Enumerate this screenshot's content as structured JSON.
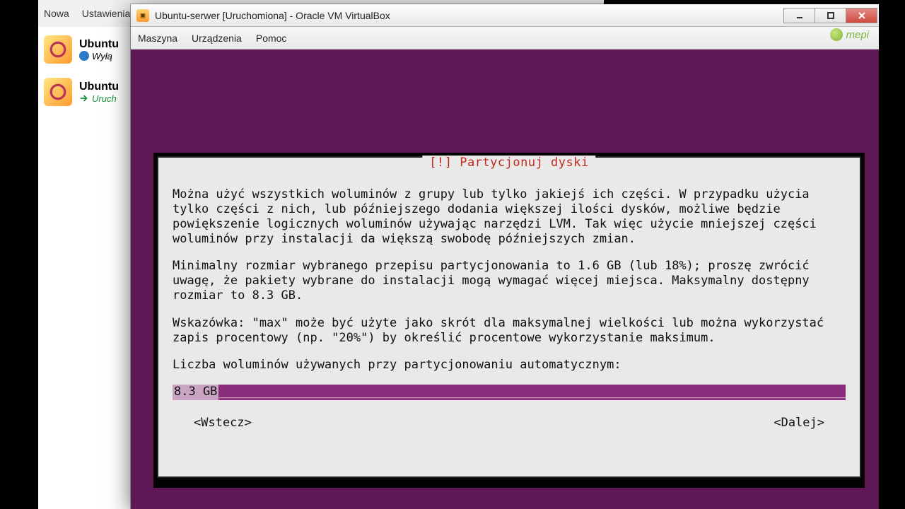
{
  "manager": {
    "toolbar": {
      "nowa": "Nowa",
      "ustawienia": "Ustawienia"
    },
    "vms": [
      {
        "name": "Ubuntu",
        "state_label": "Wyłą",
        "state": "off"
      },
      {
        "name": "Ubuntu",
        "state_label": "Uruch",
        "state": "running"
      }
    ]
  },
  "vm_window": {
    "title": "Ubuntu-serwer [Uruchomiona] - Oracle VM VirtualBox",
    "menu": {
      "maszyna": "Maszyna",
      "urzadzenia": "Urządzenia",
      "pomoc": "Pomoc"
    },
    "watermark": "mepi"
  },
  "installer": {
    "dialog_title": "[!] Partycjonuj dyski",
    "para1": "Można użyć wszystkich woluminów z grupy lub tylko jakiejś ich części. W przypadku użycia tylko części z nich, lub późniejszego dodania większej ilości dysków, możliwe będzie powiększenie logicznych woluminów używając narzędzi LVM. Tak więc użycie mniejszej części woluminów przy instalacji da większą swobodę późniejszych zmian.",
    "para2": "Minimalny rozmiar wybranego przepisu partycjonowania to 1.6 GB (lub 18%); proszę zwrócić uwagę, że pakiety wybrane do instalacji mogą wymagać więcej miejsca. Maksymalny dostępny rozmiar to 8.3 GB.",
    "para3": "Wskazówka: \"max\" może być użyte jako skrót dla maksymalnej wielkości lub można wykorzystać zapis procentowy (np. \"20%\") by określić procentowe wykorzystanie maksimum.",
    "prompt": "Liczba woluminów używanych przy partycjonowaniu automatycznym:",
    "input_value": "8.3 GB",
    "back_label": "<Wstecz>",
    "next_label": "<Dalej>"
  }
}
